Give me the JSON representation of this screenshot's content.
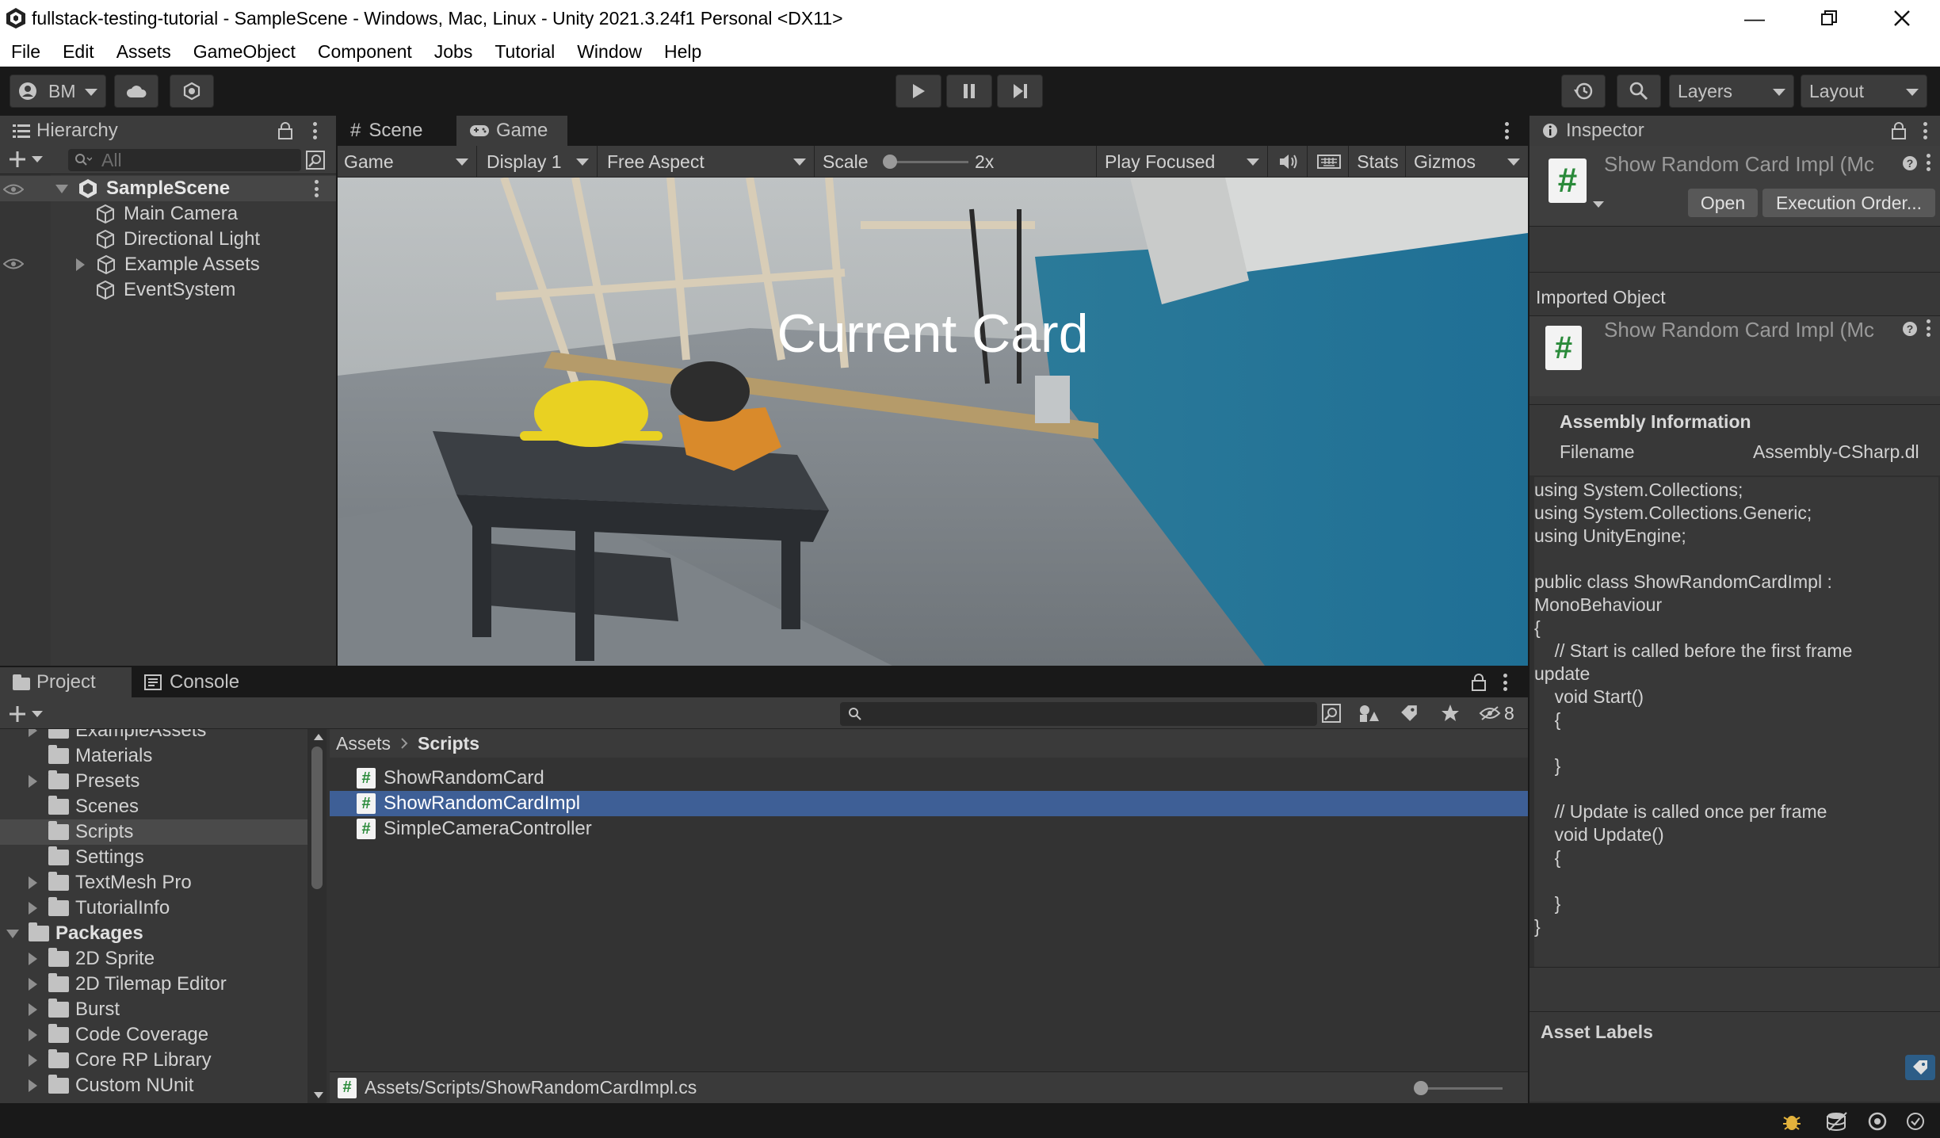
{
  "window": {
    "title": "fullstack-testing-tutorial - SampleScene - Windows, Mac, Linux - Unity 2021.3.24f1 Personal <DX11>",
    "controls": [
      "minimize-icon",
      "restore-icon",
      "close-icon"
    ]
  },
  "menu": [
    "File",
    "Edit",
    "Assets",
    "GameObject",
    "Component",
    "Jobs",
    "Tutorial",
    "Window",
    "Help"
  ],
  "toolbar": {
    "account": "BM",
    "layers": "Layers",
    "layout": "Layout"
  },
  "hierarchy": {
    "tab": "Hierarchy",
    "search_placeholder": "All",
    "scene": "SampleScene",
    "items": [
      "Main Camera",
      "Directional Light",
      "Example Assets",
      "EventSystem"
    ]
  },
  "game_view": {
    "tabs": [
      "Scene",
      "Game"
    ],
    "display_mode": "Game",
    "display": "Display 1",
    "aspect": "Free Aspect",
    "scale_label": "Scale",
    "scale_value": "2x",
    "play_mode": "Play Focused",
    "stats": "Stats",
    "gizmos": "Gizmos",
    "overlay_text": "Current Card"
  },
  "project": {
    "tabs": [
      "Project",
      "Console"
    ],
    "hidden_count": "8",
    "tree": [
      {
        "label": "ExampleAssets",
        "indent": 1,
        "expand": "right"
      },
      {
        "label": "Materials",
        "indent": 1,
        "expand": "none"
      },
      {
        "label": "Presets",
        "indent": 1,
        "expand": "right"
      },
      {
        "label": "Scenes",
        "indent": 1,
        "expand": "none"
      },
      {
        "label": "Scripts",
        "indent": 1,
        "expand": "none",
        "selected": true
      },
      {
        "label": "Settings",
        "indent": 1,
        "expand": "none"
      },
      {
        "label": "TextMesh Pro",
        "indent": 1,
        "expand": "right"
      },
      {
        "label": "TutorialInfo",
        "indent": 1,
        "expand": "right"
      },
      {
        "label": "Packages",
        "indent": 0,
        "expand": "down",
        "bold": true
      },
      {
        "label": "2D Sprite",
        "indent": 1,
        "expand": "right"
      },
      {
        "label": "2D Tilemap Editor",
        "indent": 1,
        "expand": "right"
      },
      {
        "label": "Burst",
        "indent": 1,
        "expand": "right"
      },
      {
        "label": "Code Coverage",
        "indent": 1,
        "expand": "right"
      },
      {
        "label": "Core RP Library",
        "indent": 1,
        "expand": "right"
      },
      {
        "label": "Custom NUnit",
        "indent": 1,
        "expand": "right"
      }
    ],
    "breadcrumb": [
      "Assets",
      "Scripts"
    ],
    "files": [
      "ShowRandomCard",
      "ShowRandomCardImpl",
      "SimpleCameraController"
    ],
    "selected_file": "ShowRandomCardImpl",
    "status_path": "Assets/Scripts/ShowRandomCardImpl.cs"
  },
  "inspector": {
    "tab": "Inspector",
    "header_title": "Show Random Card Impl (Mc",
    "open_button": "Open",
    "execution_order_button": "Execution Order...",
    "imported_object_label": "Imported Object",
    "imported_title": "Show Random Card Impl (Mc",
    "assembly_header": "Assembly Information",
    "filename_label": "Filename",
    "filename_value": "Assembly-CSharp.dl",
    "code": "using System.Collections;\nusing System.Collections.Generic;\nusing UnityEngine;\n\npublic class ShowRandomCardImpl :\nMonoBehaviour\n{\n    // Start is called before the first frame\nupdate\n    void Start()\n    {\n\n    }\n\n    // Update is called once per frame\n    void Update()\n    {\n\n    }\n}",
    "asset_labels": "Asset Labels"
  },
  "colors": {
    "selection": "#2c5d87",
    "panel": "#383838",
    "tab_active": "#3c3c3c",
    "background": "#191919",
    "file_selected": "#3e5f96"
  }
}
